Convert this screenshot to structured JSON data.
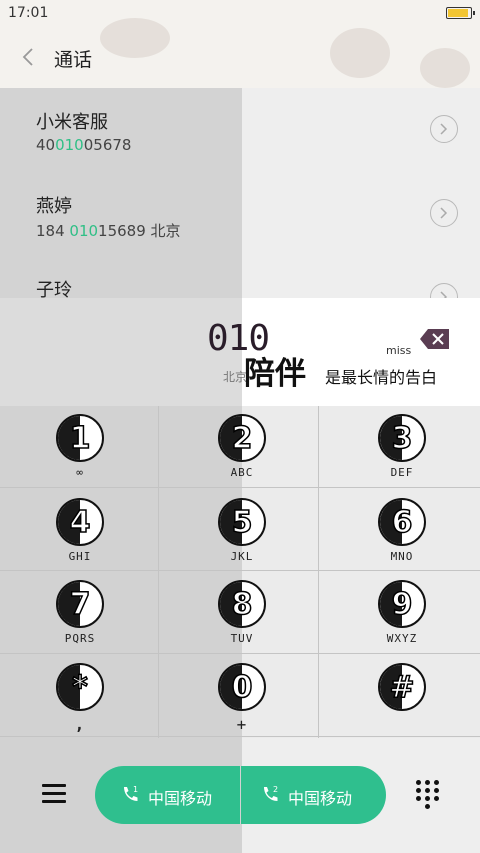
{
  "status": {
    "time": "17:01"
  },
  "header": {
    "title": "通话"
  },
  "results": [
    {
      "name": "小米客服",
      "number_pre": "40",
      "number_hl": "010",
      "number_post": "05678",
      "location": ""
    },
    {
      "name": "燕婷",
      "number_pre": "184 ",
      "number_hl": "010",
      "number_post": "15689",
      "location": "北京"
    },
    {
      "name": "子玲",
      "number_pre": "",
      "number_hl": "",
      "number_post": "",
      "location": ""
    }
  ],
  "display": {
    "number": "010",
    "location": "北京"
  },
  "decoration": {
    "phrase": "陪伴",
    "phrase_rest": "是最长情的告白",
    "miss": "miss"
  },
  "keys": [
    {
      "digit": "1",
      "letters": "∞"
    },
    {
      "digit": "2",
      "letters": "ABC"
    },
    {
      "digit": "3",
      "letters": "DEF"
    },
    {
      "digit": "4",
      "letters": "GHI"
    },
    {
      "digit": "5",
      "letters": "JKL"
    },
    {
      "digit": "6",
      "letters": "MNO"
    },
    {
      "digit": "7",
      "letters": "PQRS"
    },
    {
      "digit": "8",
      "letters": "TUV"
    },
    {
      "digit": "9",
      "letters": "WXYZ"
    },
    {
      "digit": "*",
      "letters": ","
    },
    {
      "digit": "0",
      "letters": "+"
    },
    {
      "digit": "#",
      "letters": ""
    }
  ],
  "bottom": {
    "sim1_label": "中国移动",
    "sim2_label": "中国移动",
    "sim1_index": "1",
    "sim2_index": "2"
  },
  "colors": {
    "accent": "#2fbf8e",
    "highlight": "#2fbf86"
  }
}
